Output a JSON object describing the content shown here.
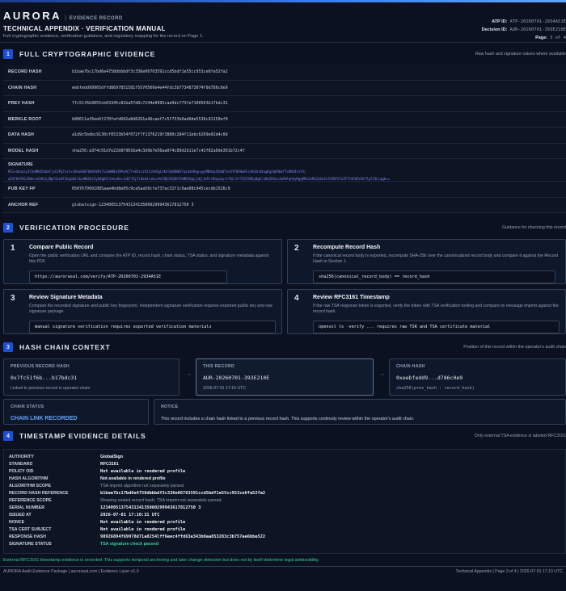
{
  "header": {
    "brand": "AURORA",
    "separator": "|",
    "brand_tag": "EVIDENCE RECORD",
    "title": "TECHNICAL APPENDIX · VERIFICATION MANUAL",
    "subtitle": "Full cryptographic evidence, verification guidance, and regulatory mapping for the record on Page 1.",
    "atp_label": "ATP ID:",
    "atp_value": "ATP-20260701-2934A51E",
    "decision_label": "Decision ID:",
    "decision_value": "AUR-20260701-393E210E",
    "page_label": "Page:",
    "page_value": "3 of 4"
  },
  "section1": {
    "num": "1",
    "title": "FULL CRYPTOGRAPHIC EVIDENCE",
    "note": "Raw hash and signature values where available",
    "rows": [
      {
        "key": "RECORD HASH",
        "value": "b1bae7bc17bd6e4758dbbbdf3c336e06763591ccd5bdf1e55cc953ce6fa52fa2"
      },
      {
        "key": "CHAIN HASH",
        "value": "eebfedd99965dffd8697851581f5570560e4e44fdc3b7734873074f9d786c0e9"
      },
      {
        "key": "PREV HASH",
        "value": "7fc51f6b9055cb03345c81ba57d0c7244e0995cae0dcf73fe7100563b17bdc31"
      },
      {
        "key": "MERKLE ROOT",
        "value": "b80611af6ee6f270fafd602a8d6261a46caef7c5f733b0ad0de5536c91250ef9"
      },
      {
        "key": "DATA HASH",
        "value": "a1d9c5bdbc9130cf0533b54f072f7f1376219f3880c284f11ebc6269e02d4c0d"
      },
      {
        "key": "MODEL HASH",
        "value": "sha256:a3f4c91d7e22b8f9016a4c3d9b7e56aa0f4c89d2b11e7c43f82a0de391b72c4f"
      }
    ],
    "signature_key": "SIGNATURE",
    "signature_lines": [
      "RX1+4anaiy372eM6654daFjnI2Pg7uz1+iKduAbEFQH4dVRi7u3aWH8h19PyAC7Y+B3zcz9JJzVeSgLtK47pNVW8X7qs4aS9qp+gyVNKbuU2bOdTnsXYF04Hw6Fzn9d2nd4ugKgZqG9bGfTc8Bt8/ef3/",
      "wISF8eP0133Wecs6S83xjNpF4xLHFZkqGbGt3uoM6Sbt2yS0gHJtJenx8e+JwEF7AjIrOaA4rxbcx9e7QKJ5QGKF5bMHZXgLjnKjJkFCrHGpxAyrtf6L7zY75ZC8VDyBgE/nDkZPUzxJwPmFqhAyHgq9RkJeRUJz0x1h7AfBF57xZF7YdCK9x5677g723Liqgk+="
    ],
    "pub_key": "PUB KEY FP",
    "pub_val": "050767009108Saae4bd8e05c9ca5aa50cfe737ac31f1c9ae08c945cecdb1526c9",
    "anchor_key": "ANCHOR REF",
    "anchor_val": "globalsign-1234005137543134135060299943617812750 3"
  },
  "section2": {
    "num": "2",
    "title": "VERIFICATION PROCEDURE",
    "note": "Guidance for checking this record",
    "cards": [
      {
        "n": "1",
        "title": "Compare Public Record",
        "desc": "Open the public verification URL and compare the ATP ID, record hash, chain status, TSA status, and signature metadata against this PDF.",
        "code": "https://aurorasal.com/verify/ATP-20260701-2934A51E"
      },
      {
        "n": "2",
        "title": "Recompute Record Hash",
        "desc": "If the canonical record body is exported, recompute SHA-256 over the canonicalized record body and compare it against the Record Hash in Section 1.",
        "code": "sha256(canonical_record_body) == record_hash"
      },
      {
        "n": "3",
        "title": "Review Signature Metadata",
        "desc": "Compare the recorded signature and public key fingerprint. Independent signature verification requires exported public key and raw signature package.",
        "code": "manual signature verification requires exported verification materials"
      },
      {
        "n": "4",
        "title": "Review RFC3161 Timestamp",
        "desc": "If the raw TSA response token is exported, verify the token with TSA verification tooling and compare its message imprint against the record hash.",
        "code": "openssl ts -verify ... requires raw TSR and TSA certificate material"
      }
    ]
  },
  "section3": {
    "num": "3",
    "title": "HASH CHAIN CONTEXT",
    "note": "Position of this record within the operator's audit chain",
    "prev_label": "PREVIOUS RECORD HASH",
    "prev_value": "0x7fc51f6b...b17bdc31",
    "prev_sub": "Linked to previous record in operator chain",
    "this_label": "THIS RECORD",
    "this_value": "AUR-20260701-393E210E",
    "this_sub": "2026-07-01 17:10 UTC",
    "chain_label": "CHAIN HASH",
    "chain_value": "0xeebfedd9...d786c0e9",
    "chain_sub": "sha256(prev_hash : record_hash)",
    "arrow": "→",
    "status_label": "CHAIN STATUS",
    "status_value": "CHAIN LINK RECORDED",
    "notice_label": "NOTICE",
    "notice_text": "This record includes a chain hash linked to a previous record hash. This supports continuity review within the operator's audit chain."
  },
  "section4": {
    "num": "4",
    "title": "TIMESTAMP EVIDENCE DETAILS",
    "note": "Only external TSA evidence is labeled RFC3161",
    "rows": [
      {
        "key": "AUTHORITY",
        "value": "GlobalSign",
        "style": "white"
      },
      {
        "key": "STANDARD",
        "value": "RFC3161",
        "style": "white"
      },
      {
        "key": "POLICY OID",
        "value": "Not available in rendered profile",
        "style": "white monov"
      },
      {
        "key": "HASH ALGORITHM",
        "value": "Not available in rendered profile",
        "style": "white"
      },
      {
        "key": "ALGORITHM SCOPE",
        "value": "TSA imprint algorithm not separately parsed.",
        "style": "gray"
      },
      {
        "key": "RECORD HASH REFERENCE",
        "value": "b1bae7bc17bd6e4758dbbbdf3c336e06763591ccd5bdf1e55cc953ce6fa52fa2",
        "style": "white monov"
      },
      {
        "key": "REFERENCE SCOPE",
        "value": "Showing sealed record hash; TSA imprint not separately parsed.",
        "style": "gray"
      },
      {
        "key": "SERIAL NUMBER",
        "value": "1234005137543134135060299943617812750 3",
        "style": "white monov"
      },
      {
        "key": "ISSUED AT",
        "value": "2026-07-01 17:10:31 UTC",
        "style": "white monov"
      },
      {
        "key": "NONCE",
        "value": "Not available in rendered profile",
        "style": "white monov"
      },
      {
        "key": "TSA CERT SUBJECT",
        "value": "Not available in rendered profile",
        "style": "white monov"
      },
      {
        "key": "RESPONSE HASH",
        "value": "98926894f69978d71a8254lff6eec4ffd63e343b0aa853283c3b757ae6bbe522",
        "style": "white monov"
      },
      {
        "key": "SIGNATURE STATUS",
        "value": "TSA signature check passed",
        "style": "green"
      }
    ]
  },
  "ext_note": "External RFC3161 timestamp evidence is recorded. This supports temporal anchoring and later change detection but does not by itself determine legal admissibility.",
  "footer": {
    "left": "AURORA Audit Evidence Package | aurorasal.com | Evidence Layer v1.0",
    "right": "Technical Appendix | Page 3 of 4 | 2026-07-01 17:10 UTC"
  }
}
